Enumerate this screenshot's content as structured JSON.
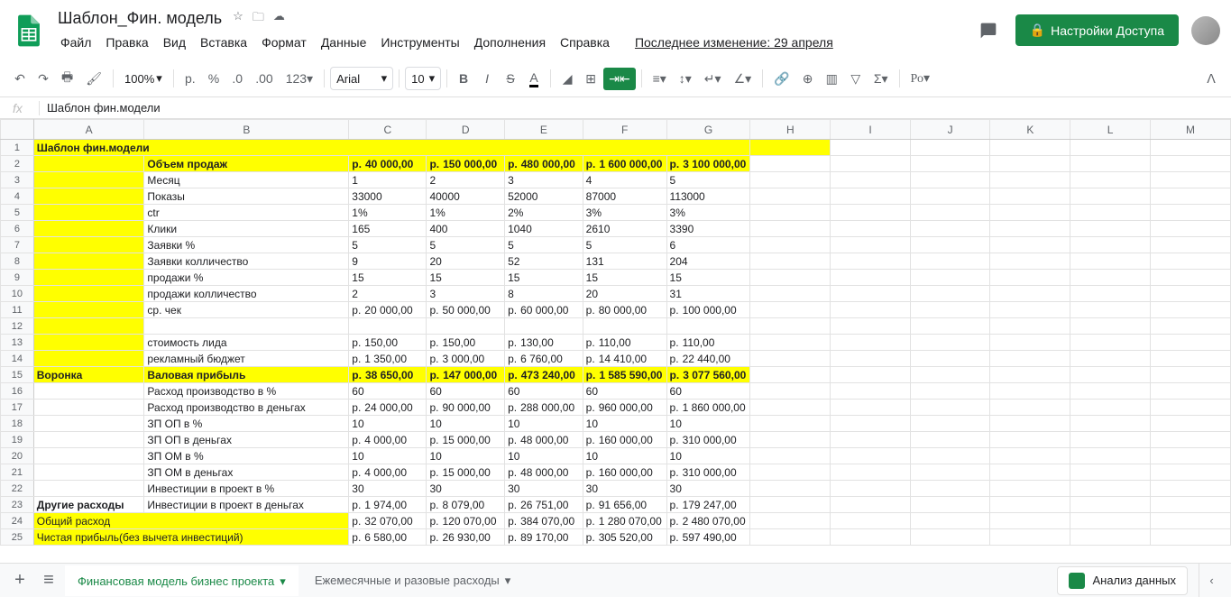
{
  "doc": {
    "title": "Шаблон_Фин. модель"
  },
  "menus": [
    "Файл",
    "Правка",
    "Вид",
    "Вставка",
    "Формат",
    "Данные",
    "Инструменты",
    "Дополнения",
    "Справка"
  ],
  "lastEdit": "Последнее изменение: 29 апреля",
  "share": "Настройки Доступа",
  "toolbar": {
    "zoom": "100%",
    "font": "Arial",
    "size": "10"
  },
  "fx": "Шаблон фин.модели",
  "cols": [
    "A",
    "B",
    "C",
    "D",
    "E",
    "F",
    "G",
    "H",
    "I",
    "J",
    "K",
    "L",
    "M"
  ],
  "rows": [
    {
      "n": 1,
      "cells": [
        {
          "t": "Шаблон фин.модели",
          "cls": "title-cell",
          "span": 7
        },
        {
          "t": "",
          "cls": "y"
        },
        {
          "t": ""
        },
        {
          "t": ""
        },
        {
          "t": ""
        },
        {
          "t": ""
        },
        {
          "t": ""
        }
      ]
    },
    {
      "n": 2,
      "cells": [
        {
          "t": "",
          "cls": "y"
        },
        {
          "t": "Объем продаж",
          "cls": "y b"
        },
        {
          "t": "40 000,00",
          "cls": "r y b",
          "p": "р."
        },
        {
          "t": "150 000,00",
          "cls": "r y b",
          "p": "р."
        },
        {
          "t": "480 000,00",
          "cls": "r y b",
          "p": "р."
        },
        {
          "t": "1 600 000,00",
          "cls": "r y b",
          "p": "р."
        },
        {
          "t": "3 100 000,00",
          "cls": "r y b",
          "p": "р."
        },
        {
          "t": ""
        },
        {
          "t": ""
        },
        {
          "t": ""
        },
        {
          "t": ""
        },
        {
          "t": ""
        },
        {
          "t": ""
        }
      ]
    },
    {
      "n": 3,
      "cells": [
        {
          "t": "",
          "cls": "y"
        },
        {
          "t": "Месяц"
        },
        {
          "t": "1",
          "cls": "r"
        },
        {
          "t": "2",
          "cls": "r"
        },
        {
          "t": "3",
          "cls": "r"
        },
        {
          "t": "4",
          "cls": "r"
        },
        {
          "t": "5",
          "cls": "r"
        },
        {
          "t": ""
        },
        {
          "t": ""
        },
        {
          "t": ""
        },
        {
          "t": ""
        },
        {
          "t": ""
        },
        {
          "t": ""
        }
      ]
    },
    {
      "n": 4,
      "cells": [
        {
          "t": "",
          "cls": "y"
        },
        {
          "t": "Показы"
        },
        {
          "t": "33000",
          "cls": "r"
        },
        {
          "t": "40000",
          "cls": "r"
        },
        {
          "t": "52000",
          "cls": "r"
        },
        {
          "t": "87000",
          "cls": "r"
        },
        {
          "t": "113000",
          "cls": "r"
        },
        {
          "t": ""
        },
        {
          "t": ""
        },
        {
          "t": ""
        },
        {
          "t": ""
        },
        {
          "t": ""
        },
        {
          "t": ""
        }
      ]
    },
    {
      "n": 5,
      "cells": [
        {
          "t": "",
          "cls": "y"
        },
        {
          "t": "ctr"
        },
        {
          "t": "1%",
          "cls": "r"
        },
        {
          "t": "1%",
          "cls": "r"
        },
        {
          "t": "2%",
          "cls": "r"
        },
        {
          "t": "3%",
          "cls": "r"
        },
        {
          "t": "3%",
          "cls": "r"
        },
        {
          "t": ""
        },
        {
          "t": ""
        },
        {
          "t": ""
        },
        {
          "t": ""
        },
        {
          "t": ""
        },
        {
          "t": ""
        }
      ]
    },
    {
      "n": 6,
      "cells": [
        {
          "t": "",
          "cls": "y"
        },
        {
          "t": "Клики"
        },
        {
          "t": "165",
          "cls": "r"
        },
        {
          "t": "400",
          "cls": "r"
        },
        {
          "t": "1040",
          "cls": "r"
        },
        {
          "t": "2610",
          "cls": "r"
        },
        {
          "t": "3390",
          "cls": "r"
        },
        {
          "t": ""
        },
        {
          "t": ""
        },
        {
          "t": ""
        },
        {
          "t": ""
        },
        {
          "t": ""
        },
        {
          "t": ""
        }
      ]
    },
    {
      "n": 7,
      "cells": [
        {
          "t": "",
          "cls": "y"
        },
        {
          "t": "Заявки %"
        },
        {
          "t": "5",
          "cls": "r"
        },
        {
          "t": "5",
          "cls": "r"
        },
        {
          "t": "5",
          "cls": "r"
        },
        {
          "t": "5",
          "cls": "r"
        },
        {
          "t": "6",
          "cls": "r"
        },
        {
          "t": ""
        },
        {
          "t": ""
        },
        {
          "t": ""
        },
        {
          "t": ""
        },
        {
          "t": ""
        },
        {
          "t": ""
        }
      ]
    },
    {
      "n": 8,
      "cells": [
        {
          "t": "",
          "cls": "y"
        },
        {
          "t": "Заявки колличество"
        },
        {
          "t": "9",
          "cls": "r"
        },
        {
          "t": "20",
          "cls": "r"
        },
        {
          "t": "52",
          "cls": "r"
        },
        {
          "t": "131",
          "cls": "r"
        },
        {
          "t": "204",
          "cls": "r"
        },
        {
          "t": ""
        },
        {
          "t": ""
        },
        {
          "t": ""
        },
        {
          "t": ""
        },
        {
          "t": ""
        },
        {
          "t": ""
        }
      ]
    },
    {
      "n": 9,
      "cells": [
        {
          "t": "",
          "cls": "y"
        },
        {
          "t": "продажи %"
        },
        {
          "t": "15",
          "cls": "r"
        },
        {
          "t": "15",
          "cls": "r"
        },
        {
          "t": "15",
          "cls": "r"
        },
        {
          "t": "15",
          "cls": "r"
        },
        {
          "t": "15",
          "cls": "r"
        },
        {
          "t": ""
        },
        {
          "t": ""
        },
        {
          "t": ""
        },
        {
          "t": ""
        },
        {
          "t": ""
        },
        {
          "t": ""
        }
      ]
    },
    {
      "n": 10,
      "cells": [
        {
          "t": "",
          "cls": "y"
        },
        {
          "t": "продажи колличество"
        },
        {
          "t": "2",
          "cls": "r"
        },
        {
          "t": "3",
          "cls": "r"
        },
        {
          "t": "8",
          "cls": "r"
        },
        {
          "t": "20",
          "cls": "r"
        },
        {
          "t": "31",
          "cls": "r"
        },
        {
          "t": ""
        },
        {
          "t": ""
        },
        {
          "t": ""
        },
        {
          "t": ""
        },
        {
          "t": ""
        },
        {
          "t": ""
        }
      ]
    },
    {
      "n": 11,
      "cells": [
        {
          "t": "",
          "cls": "y"
        },
        {
          "t": "ср. чек"
        },
        {
          "t": "20 000,00",
          "cls": "r",
          "p": "р."
        },
        {
          "t": "50 000,00",
          "cls": "r",
          "p": "р."
        },
        {
          "t": "60 000,00",
          "cls": "r",
          "p": "р."
        },
        {
          "t": "80 000,00",
          "cls": "r",
          "p": "р."
        },
        {
          "t": "100 000,00",
          "cls": "r",
          "p": "р."
        },
        {
          "t": ""
        },
        {
          "t": ""
        },
        {
          "t": ""
        },
        {
          "t": ""
        },
        {
          "t": ""
        },
        {
          "t": ""
        }
      ]
    },
    {
      "n": 12,
      "cells": [
        {
          "t": "",
          "cls": "y"
        },
        {
          "t": ""
        },
        {
          "t": ""
        },
        {
          "t": ""
        },
        {
          "t": ""
        },
        {
          "t": ""
        },
        {
          "t": ""
        },
        {
          "t": ""
        },
        {
          "t": ""
        },
        {
          "t": ""
        },
        {
          "t": ""
        },
        {
          "t": ""
        },
        {
          "t": ""
        }
      ]
    },
    {
      "n": 13,
      "cells": [
        {
          "t": "",
          "cls": "y"
        },
        {
          "t": "стоимость лида"
        },
        {
          "t": "150,00",
          "cls": "r",
          "p": "р."
        },
        {
          "t": "150,00",
          "cls": "r",
          "p": "р."
        },
        {
          "t": "130,00",
          "cls": "r",
          "p": "р."
        },
        {
          "t": "110,00",
          "cls": "r",
          "p": "р."
        },
        {
          "t": "110,00",
          "cls": "r",
          "p": "р."
        },
        {
          "t": ""
        },
        {
          "t": ""
        },
        {
          "t": ""
        },
        {
          "t": ""
        },
        {
          "t": ""
        },
        {
          "t": ""
        }
      ]
    },
    {
      "n": 14,
      "cells": [
        {
          "t": "",
          "cls": "y"
        },
        {
          "t": "рекламный бюджет"
        },
        {
          "t": "1 350,00",
          "cls": "r",
          "p": "р."
        },
        {
          "t": "3 000,00",
          "cls": "r",
          "p": "р."
        },
        {
          "t": "6 760,00",
          "cls": "r",
          "p": "р."
        },
        {
          "t": "14 410,00",
          "cls": "r",
          "p": "р."
        },
        {
          "t": "22 440,00",
          "cls": "r",
          "p": "р."
        },
        {
          "t": ""
        },
        {
          "t": ""
        },
        {
          "t": ""
        },
        {
          "t": ""
        },
        {
          "t": ""
        },
        {
          "t": ""
        }
      ]
    },
    {
      "n": 15,
      "cells": [
        {
          "t": "Воронка",
          "cls": "y b c"
        },
        {
          "t": "Валовая прибыль",
          "cls": "y b"
        },
        {
          "t": "38 650,00",
          "cls": "r y b",
          "p": "р."
        },
        {
          "t": "147 000,00",
          "cls": "r y b",
          "p": "р."
        },
        {
          "t": "473 240,00",
          "cls": "r y b",
          "p": "р."
        },
        {
          "t": "1 585 590,00",
          "cls": "r y b",
          "p": "р."
        },
        {
          "t": "3 077 560,00",
          "cls": "r y b",
          "p": "р."
        },
        {
          "t": ""
        },
        {
          "t": ""
        },
        {
          "t": ""
        },
        {
          "t": ""
        },
        {
          "t": ""
        },
        {
          "t": ""
        }
      ]
    },
    {
      "n": 16,
      "cells": [
        {
          "t": ""
        },
        {
          "t": "Расход производство в %"
        },
        {
          "t": "60",
          "cls": "r"
        },
        {
          "t": "60",
          "cls": "r"
        },
        {
          "t": "60",
          "cls": "r"
        },
        {
          "t": "60",
          "cls": "r"
        },
        {
          "t": "60",
          "cls": "r"
        },
        {
          "t": ""
        },
        {
          "t": ""
        },
        {
          "t": ""
        },
        {
          "t": ""
        },
        {
          "t": ""
        },
        {
          "t": ""
        }
      ]
    },
    {
      "n": 17,
      "cells": [
        {
          "t": ""
        },
        {
          "t": "Расход производство в деньгах"
        },
        {
          "t": "24 000,00",
          "cls": "r",
          "p": "р."
        },
        {
          "t": "90 000,00",
          "cls": "r",
          "p": "р."
        },
        {
          "t": "288 000,00",
          "cls": "r",
          "p": "р."
        },
        {
          "t": "960 000,00",
          "cls": "r",
          "p": "р."
        },
        {
          "t": "1 860 000,00",
          "cls": "r",
          "p": "р."
        },
        {
          "t": ""
        },
        {
          "t": ""
        },
        {
          "t": ""
        },
        {
          "t": ""
        },
        {
          "t": ""
        },
        {
          "t": ""
        }
      ]
    },
    {
      "n": 18,
      "cells": [
        {
          "t": ""
        },
        {
          "t": "ЗП ОП в %"
        },
        {
          "t": "10",
          "cls": "r"
        },
        {
          "t": "10",
          "cls": "r"
        },
        {
          "t": "10",
          "cls": "r"
        },
        {
          "t": "10",
          "cls": "r"
        },
        {
          "t": "10",
          "cls": "r"
        },
        {
          "t": ""
        },
        {
          "t": ""
        },
        {
          "t": ""
        },
        {
          "t": ""
        },
        {
          "t": ""
        },
        {
          "t": ""
        }
      ]
    },
    {
      "n": 19,
      "cells": [
        {
          "t": ""
        },
        {
          "t": "ЗП ОП в деньгах"
        },
        {
          "t": "4 000,00",
          "cls": "r",
          "p": "р."
        },
        {
          "t": "15 000,00",
          "cls": "r",
          "p": "р."
        },
        {
          "t": "48 000,00",
          "cls": "r",
          "p": "р."
        },
        {
          "t": "160 000,00",
          "cls": "r",
          "p": "р."
        },
        {
          "t": "310 000,00",
          "cls": "r",
          "p": "р."
        },
        {
          "t": ""
        },
        {
          "t": ""
        },
        {
          "t": ""
        },
        {
          "t": ""
        },
        {
          "t": ""
        },
        {
          "t": ""
        }
      ]
    },
    {
      "n": 20,
      "cells": [
        {
          "t": ""
        },
        {
          "t": "ЗП ОМ в %"
        },
        {
          "t": "10",
          "cls": "r"
        },
        {
          "t": "10",
          "cls": "r"
        },
        {
          "t": "10",
          "cls": "r"
        },
        {
          "t": "10",
          "cls": "r"
        },
        {
          "t": "10",
          "cls": "r"
        },
        {
          "t": ""
        },
        {
          "t": ""
        },
        {
          "t": ""
        },
        {
          "t": ""
        },
        {
          "t": ""
        },
        {
          "t": ""
        }
      ]
    },
    {
      "n": 21,
      "cells": [
        {
          "t": ""
        },
        {
          "t": "ЗП ОМ в деньгах"
        },
        {
          "t": "4 000,00",
          "cls": "r",
          "p": "р."
        },
        {
          "t": "15 000,00",
          "cls": "r",
          "p": "р."
        },
        {
          "t": "48 000,00",
          "cls": "r",
          "p": "р."
        },
        {
          "t": "160 000,00",
          "cls": "r",
          "p": "р."
        },
        {
          "t": "310 000,00",
          "cls": "r",
          "p": "р."
        },
        {
          "t": ""
        },
        {
          "t": ""
        },
        {
          "t": ""
        },
        {
          "t": ""
        },
        {
          "t": ""
        },
        {
          "t": ""
        }
      ]
    },
    {
      "n": 22,
      "cells": [
        {
          "t": ""
        },
        {
          "t": "Инвестиции в проект в %"
        },
        {
          "t": "30",
          "cls": "r"
        },
        {
          "t": "30",
          "cls": "r"
        },
        {
          "t": "30",
          "cls": "r"
        },
        {
          "t": "30",
          "cls": "r"
        },
        {
          "t": "30",
          "cls": "r"
        },
        {
          "t": ""
        },
        {
          "t": ""
        },
        {
          "t": ""
        },
        {
          "t": ""
        },
        {
          "t": ""
        },
        {
          "t": ""
        }
      ]
    },
    {
      "n": 23,
      "cells": [
        {
          "t": "Другие расходы",
          "cls": "b c"
        },
        {
          "t": "Инвестиции в проект в деньгах"
        },
        {
          "t": "1 974,00",
          "cls": "r",
          "p": "р."
        },
        {
          "t": "8 079,00",
          "cls": "r",
          "p": "р."
        },
        {
          "t": "26 751,00",
          "cls": "r",
          "p": "р."
        },
        {
          "t": "91 656,00",
          "cls": "r",
          "p": "р."
        },
        {
          "t": "179 247,00",
          "cls": "r",
          "p": "р."
        },
        {
          "t": ""
        },
        {
          "t": ""
        },
        {
          "t": ""
        },
        {
          "t": ""
        },
        {
          "t": ""
        },
        {
          "t": ""
        }
      ]
    },
    {
      "n": 24,
      "cells": [
        {
          "t": "Общий расход",
          "cls": "y c",
          "span": 2
        },
        {
          "t": "32 070,00",
          "cls": "r",
          "p": "р."
        },
        {
          "t": "120 070,00",
          "cls": "r",
          "p": "р."
        },
        {
          "t": "384 070,00",
          "cls": "r",
          "p": "р."
        },
        {
          "t": "1 280 070,00",
          "cls": "r",
          "p": "р."
        },
        {
          "t": "2 480 070,00",
          "cls": "r",
          "p": "р."
        },
        {
          "t": ""
        },
        {
          "t": ""
        },
        {
          "t": ""
        },
        {
          "t": ""
        },
        {
          "t": ""
        },
        {
          "t": ""
        }
      ]
    },
    {
      "n": 25,
      "cells": [
        {
          "t": "Чистая прибыль(без вычета инвестиций)",
          "cls": "y c",
          "span": 2
        },
        {
          "t": "6 580,00",
          "cls": "r",
          "p": "р."
        },
        {
          "t": "26 930,00",
          "cls": "r",
          "p": "р."
        },
        {
          "t": "89 170,00",
          "cls": "r",
          "p": "р."
        },
        {
          "t": "305 520,00",
          "cls": "r",
          "p": "р."
        },
        {
          "t": "597 490,00",
          "cls": "r",
          "p": "р."
        },
        {
          "t": ""
        },
        {
          "t": ""
        },
        {
          "t": ""
        },
        {
          "t": ""
        },
        {
          "t": ""
        },
        {
          "t": ""
        }
      ]
    }
  ],
  "tabs": {
    "active": "Финансовая модель бизнес проекта",
    "other": "Ежемесячные и разовые расходы"
  },
  "explore": "Анализ данных"
}
